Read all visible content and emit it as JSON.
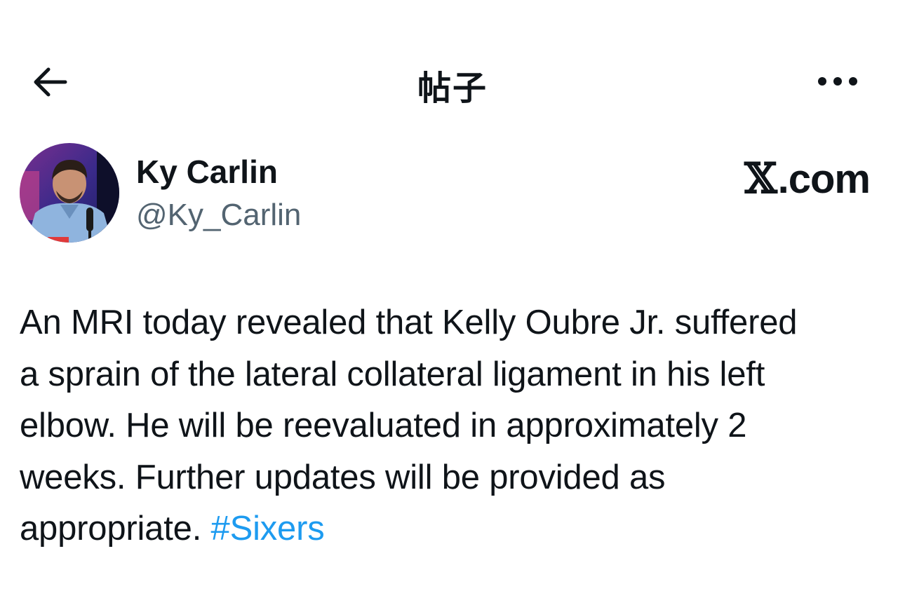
{
  "header": {
    "title": "帖子",
    "back_icon": "arrow-left-icon",
    "more_icon": "more-horizontal-icon"
  },
  "author": {
    "name": "Ky Carlin",
    "handle": "@Ky_Carlin",
    "avatar": "avatar-photo"
  },
  "brand": {
    "logo_glyph": "𝕏",
    "suffix": ".com"
  },
  "post": {
    "lines": [
      "An MRI today revealed that Kelly Oubre Jr. suffered",
      "a sprain of the lateral collateral ligament in his left",
      "elbow. He will be reevaluated in approximately 2",
      "weeks. Further updates will be provided as",
      "appropriate."
    ],
    "hashtag": "#Sixers"
  },
  "colors": {
    "text": "#0f1419",
    "secondary": "#536471",
    "link": "#1d9bf0",
    "background": "#ffffff"
  }
}
